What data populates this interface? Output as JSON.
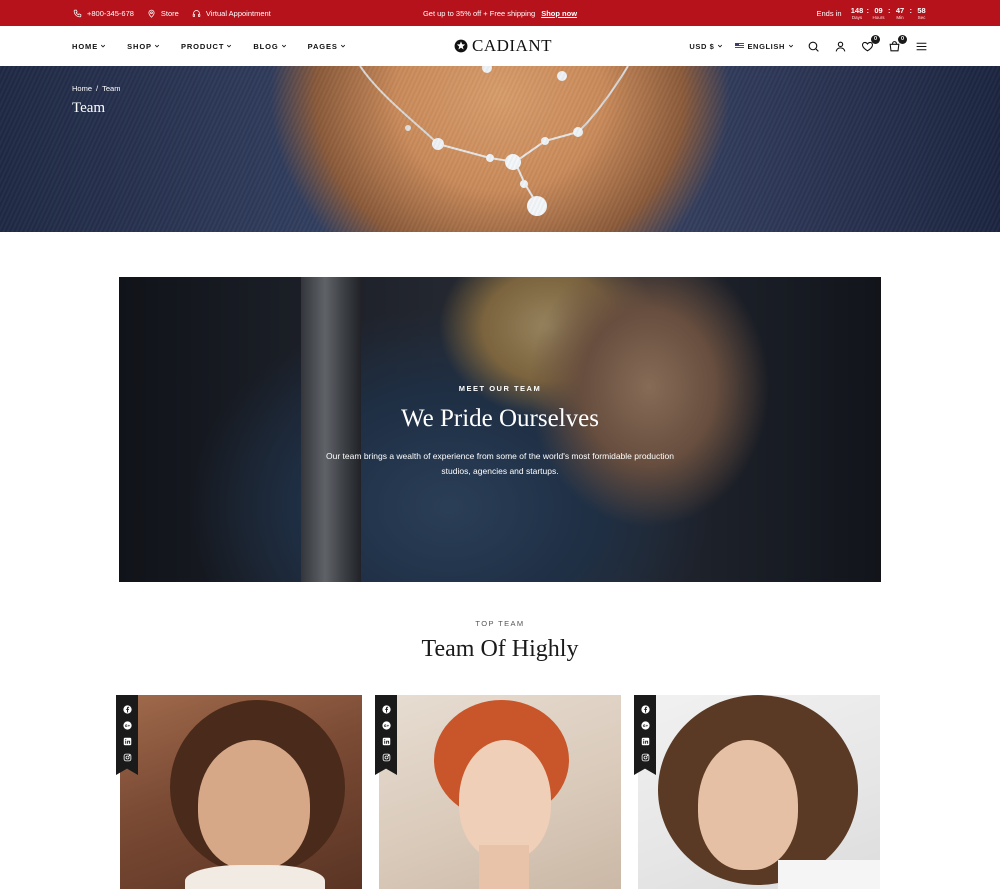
{
  "topbar": {
    "phone": "+800-345-678",
    "store": "Store",
    "appointment": "Virtual Appointment",
    "promo": "Get up to 35% off + Free shipping",
    "promo_link": "Shop now",
    "ends_in": "Ends in",
    "timer": {
      "days": "148",
      "days_label": "Days",
      "hours": "09",
      "hours_label": "Hours",
      "min": "47",
      "min_label": "Min",
      "sec": "58",
      "sec_label": "Sec"
    }
  },
  "header": {
    "nav": [
      "HOME",
      "SHOP",
      "PRODUCT",
      "BLOG",
      "PAGES"
    ],
    "logo": "CADIANT",
    "currency": "USD $",
    "language": "ENGLISH",
    "wishlist_count": "0",
    "cart_count": "0"
  },
  "hero": {
    "breadcrumb_home": "Home",
    "breadcrumb_sep": "/",
    "breadcrumb_current": "Team",
    "title": "Team"
  },
  "feature": {
    "eyebrow": "MEET OUR TEAM",
    "title": "We Pride Ourselves",
    "description": "Our team brings a wealth of experience from some of the world's most formidable production studios, agencies and startups."
  },
  "team": {
    "eyebrow": "TOP TEAM",
    "title": "Team Of Highly",
    "social_icons": [
      "facebook-icon",
      "google-plus-icon",
      "linkedin-icon",
      "instagram-icon"
    ]
  },
  "colors": {
    "topbar_bg": "#b5121b",
    "text_dark": "#1a1a1a"
  }
}
